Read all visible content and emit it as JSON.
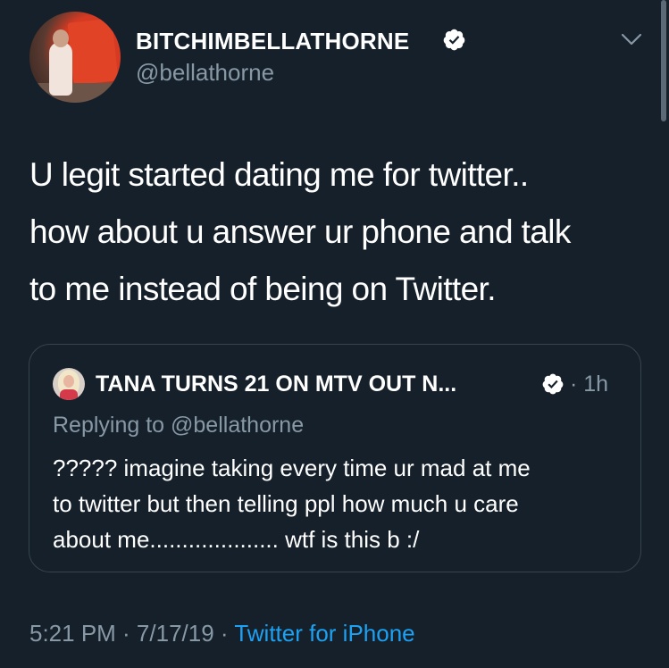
{
  "author": {
    "display_name": "BITCHIMBELLATHORNE",
    "handle": "@bellathorne",
    "verified": true
  },
  "tweet": {
    "text_lines": [
      "U legit started dating me for twitter..",
      "how about u answer ur phone and talk",
      "to me instead of being on Twitter."
    ]
  },
  "quoted_tweet": {
    "display_name": "TANA TURNS 21 ON MTV OUT N...",
    "time": "· 1h",
    "replying_to": "Replying to @bellathorne",
    "text_lines": [
      "????? imagine taking every time ur mad at me",
      "to twitter but then telling ppl how much u care",
      "about me.................... wtf is this b :/"
    ]
  },
  "meta": {
    "time": "5:21 PM · 7/17/19 · ",
    "source": "Twitter for iPhone"
  },
  "colors": {
    "background": "#15202b",
    "text": "#ffffff",
    "secondary": "#8899a6",
    "accent": "#1da1f2",
    "border": "#38444d"
  },
  "icons": {
    "verified": "verified-badge-icon",
    "menu": "chevron-down-icon"
  }
}
